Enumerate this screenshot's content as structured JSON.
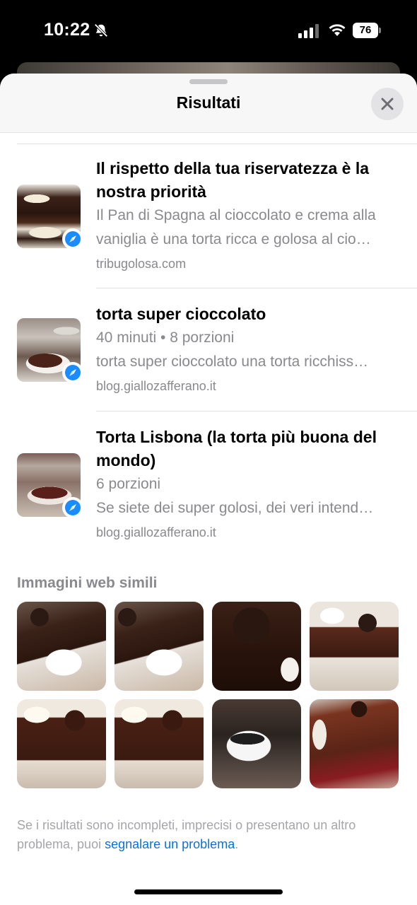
{
  "status_bar": {
    "time": "10:22",
    "battery": "76"
  },
  "sheet": {
    "title": "Risultati"
  },
  "results": [
    {
      "title": "Il rispetto della tua riservatezza è la nostra priorità",
      "meta": "",
      "description": "Il Pan di Spagna al cioccolato e crema alla vaniglia è una torta ricca e golosa al cio…",
      "source": "tribugolosa.com"
    },
    {
      "title": "torta super cioccolato",
      "meta": "40 minuti • 8 porzioni",
      "description": "torta super cioccolato una torta ricchiss…",
      "source": "blog.giallozafferano.it"
    },
    {
      "title": "Torta Lisbona (la torta più buona del mondo)",
      "meta": "6 porzioni",
      "description": "Se siete dei super golosi, dei veri intend…",
      "source": "blog.giallozafferano.it"
    }
  ],
  "similar": {
    "title": "Immagini web simili"
  },
  "footer": {
    "text": "Se i risultati sono incompleti, imprecisi o presentano un altro problema, puoi ",
    "link": "segnalare un problema",
    "end": "."
  },
  "colors": {
    "link": "#0a72d8",
    "secondary_text": "#8a8a8e",
    "safari_blue": "#1a8cff"
  },
  "icons": [
    "bell-slash-icon",
    "signal-icon",
    "wifi-icon",
    "close-icon",
    "safari-icon"
  ]
}
